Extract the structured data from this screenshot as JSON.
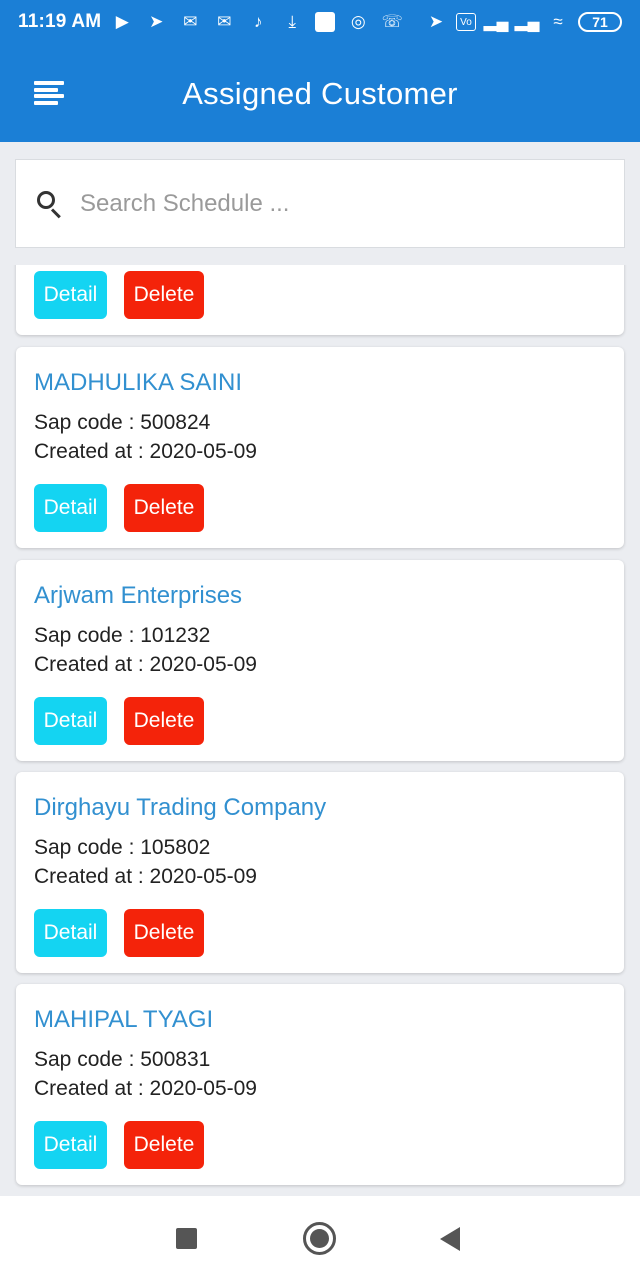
{
  "status_bar": {
    "time": "11:19 AM",
    "battery": "71",
    "left_icons": [
      "play-icon",
      "telegram-icon",
      "gmail-icon",
      "gmail-icon",
      "tiktok-icon",
      "download-icon",
      "app-icon",
      "location-target-icon",
      "whatsapp-icon"
    ],
    "right_icons": [
      "navigation-icon",
      "volte-icon",
      "signal-icon",
      "signal-icon",
      "wifi-icon"
    ]
  },
  "app_bar": {
    "title": "Assigned Customer",
    "menu_icon": "menu-icon",
    "color": "#1b7fd6"
  },
  "search": {
    "placeholder": "Search Schedule ...",
    "value": ""
  },
  "buttons": {
    "detail_label": "Detail",
    "delete_label": "Delete",
    "detail_color": "#14d4f2",
    "delete_color": "#f4230a"
  },
  "customers": [
    {
      "name": "MADHULIKA SAINI",
      "sap_line": "Sap code : 500824",
      "created_line": "Created at : 2020-05-09"
    },
    {
      "name": "Arjwam Enterprises",
      "sap_line": "Sap code : 101232",
      "created_line": "Created at : 2020-05-09"
    },
    {
      "name": "Dirghayu Trading Company",
      "sap_line": "Sap code : 105802",
      "created_line": "Created at : 2020-05-09"
    },
    {
      "name": "MAHIPAL TYAGI",
      "sap_line": "Sap code : 500831",
      "created_line": "Created at : 2020-05-09"
    }
  ],
  "nav_bar": {
    "icons": [
      "recents-square-icon",
      "home-circle-icon",
      "back-triangle-icon"
    ]
  }
}
